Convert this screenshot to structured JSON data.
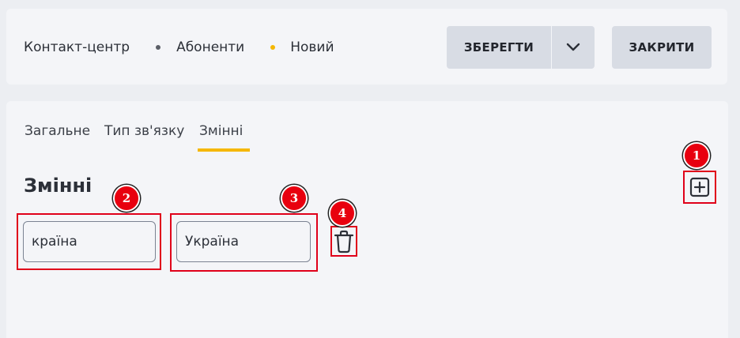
{
  "breadcrumb": {
    "items": [
      "Контакт-центр",
      "Абоненти",
      "Новий"
    ]
  },
  "header": {
    "save_label": "ЗБЕРЕГТИ",
    "close_label": "ЗАКРИТИ"
  },
  "tabs": [
    {
      "label": "Загальне"
    },
    {
      "label": "Тип зв'язку"
    },
    {
      "label": "Змінні",
      "active": true
    }
  ],
  "section": {
    "title": "Змінні"
  },
  "variables": [
    {
      "name": "країна",
      "value": "Україна"
    }
  ],
  "annotations": [
    "1",
    "2",
    "3",
    "4"
  ],
  "colors": {
    "accent": "#f5b700",
    "highlight_box": "#e0001a",
    "marker": "#e8000f",
    "button_bg": "#d8dce4"
  },
  "icons": {
    "save_dropdown": "chevron-down-icon",
    "add": "plus-square-icon",
    "delete": "trash-icon"
  }
}
